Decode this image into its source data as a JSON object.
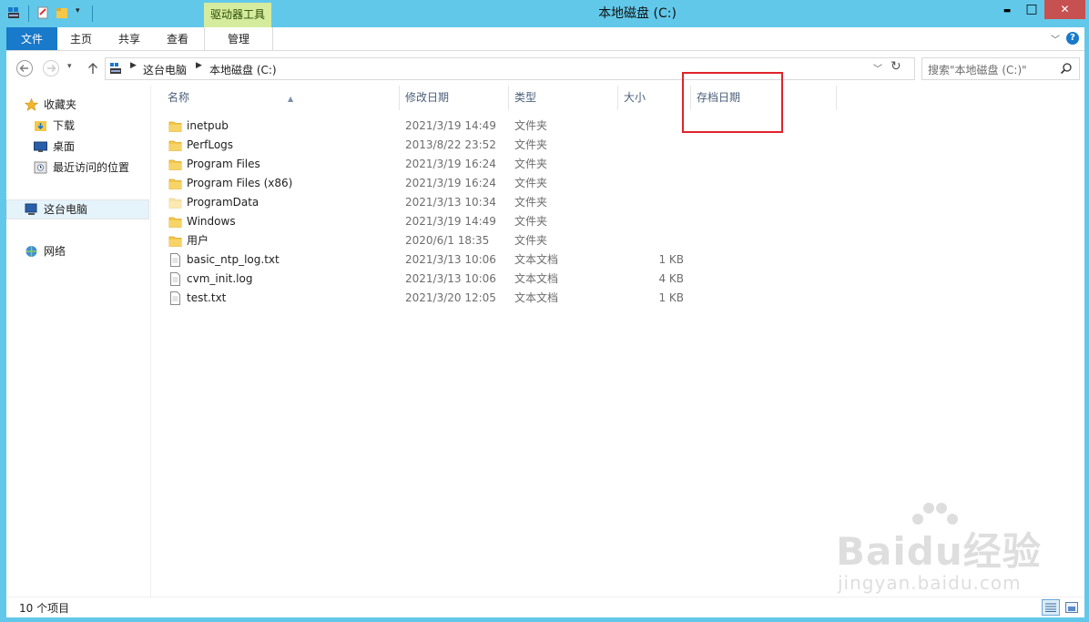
{
  "window": {
    "title": "本地磁盘 (C:)",
    "context_tab_group": "驱动器工具",
    "min_glyph": "▬",
    "max_glyph": "□",
    "close_glyph": "✕"
  },
  "ribbon": {
    "tabs": [
      {
        "label": "文件"
      },
      {
        "label": "主页"
      },
      {
        "label": "共享"
      },
      {
        "label": "查看"
      },
      {
        "label": "管理"
      }
    ],
    "help_glyph": "?"
  },
  "address": {
    "breadcrumb": [
      "这台电脑",
      "本地磁盘 (C:)"
    ],
    "search_placeholder": "搜索\"本地磁盘 (C:)\""
  },
  "nav_pane": {
    "favorites_label": "收藏夹",
    "favorites": [
      {
        "label": "下载",
        "icon": "download-folder-icon"
      },
      {
        "label": "桌面",
        "icon": "desktop-icon"
      },
      {
        "label": "最近访问的位置",
        "icon": "recent-places-icon"
      }
    ],
    "this_pc_label": "这台电脑",
    "network_label": "网络"
  },
  "columns": [
    {
      "label": "名称"
    },
    {
      "label": "修改日期"
    },
    {
      "label": "类型"
    },
    {
      "label": "大小"
    },
    {
      "label": "存档日期"
    }
  ],
  "files": [
    {
      "name": "inetpub",
      "date": "2021/3/19 14:49",
      "type": "文件夹",
      "size": "",
      "kind": "folder"
    },
    {
      "name": "PerfLogs",
      "date": "2013/8/22 23:52",
      "type": "文件夹",
      "size": "",
      "kind": "folder"
    },
    {
      "name": "Program Files",
      "date": "2021/3/19 16:24",
      "type": "文件夹",
      "size": "",
      "kind": "folder"
    },
    {
      "name": "Program Files (x86)",
      "date": "2021/3/19 16:24",
      "type": "文件夹",
      "size": "",
      "kind": "folder"
    },
    {
      "name": "ProgramData",
      "date": "2021/3/13 10:34",
      "type": "文件夹",
      "size": "",
      "kind": "folder-hidden"
    },
    {
      "name": "Windows",
      "date": "2021/3/19 14:49",
      "type": "文件夹",
      "size": "",
      "kind": "folder"
    },
    {
      "name": "用户",
      "date": "2020/6/1 18:35",
      "type": "文件夹",
      "size": "",
      "kind": "folder"
    },
    {
      "name": "basic_ntp_log.txt",
      "date": "2021/3/13 10:06",
      "type": "文本文档",
      "size": "1 KB",
      "kind": "text"
    },
    {
      "name": "cvm_init.log",
      "date": "2021/3/13 10:06",
      "type": "文本文档",
      "size": "4 KB",
      "kind": "text"
    },
    {
      "name": "test.txt",
      "date": "2021/3/20 12:05",
      "type": "文本文档",
      "size": "1 KB",
      "kind": "text"
    }
  ],
  "status": {
    "item_count": "10 个项目"
  },
  "watermark": {
    "brand": "Baidu经验",
    "url": "jingyan.baidu.com"
  },
  "colors": {
    "frame": "#62c8ea",
    "file_tab": "#1979ca",
    "context_tab": "#d5ec9e",
    "close_button": "#c75050",
    "annotation_box": "#e0232a",
    "folder": "#f4c84a"
  }
}
